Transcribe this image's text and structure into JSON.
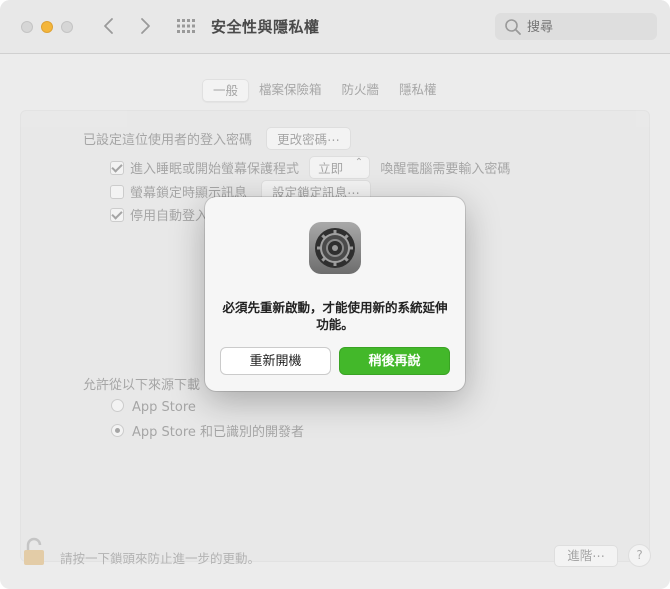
{
  "window": {
    "title": "安全性與隱私權",
    "search_placeholder": "搜尋"
  },
  "tabs": [
    {
      "label": "一般",
      "active": true
    },
    {
      "label": "檔案保險箱",
      "active": false
    },
    {
      "label": "防火牆",
      "active": false
    },
    {
      "label": "隱私權",
      "active": false
    }
  ],
  "general": {
    "password_label": "已設定這位使用者的登入密碼",
    "change_password_button": "更改密碼⋯",
    "require_password": {
      "checked": true,
      "label": "進入睡眠或開始螢幕保護程式",
      "select_value": "立即",
      "suffix": "喚醒電腦需要輸入密碼"
    },
    "lock_message": {
      "checked": false,
      "label": "螢幕鎖定時顯示訊息",
      "button": "設定鎖定訊息⋯"
    },
    "disable_auto_login": {
      "checked": true,
      "label": "停用自動登入"
    },
    "allow_apps_label": "允許從以下來源下載",
    "allow_options": [
      {
        "label": "App Store",
        "selected": false
      },
      {
        "label": "App Store 和已識別的開發者",
        "selected": true
      }
    ]
  },
  "footer": {
    "lock_text": "請按一下鎖頭來防止進一步的更動。",
    "advanced_button": "進階⋯",
    "help_button": "?"
  },
  "dialog": {
    "message": "必須先重新啟動，才能使用新的系統延伸功能。",
    "restart_button": "重新開機",
    "later_button": "稍後再說"
  },
  "colors": {
    "accent_green": "#43b82a",
    "minimize_yellow": "#f4b63b"
  }
}
